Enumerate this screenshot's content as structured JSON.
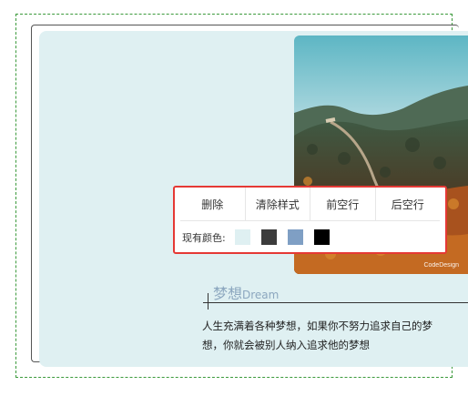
{
  "toolbar": {
    "buttons": [
      "删除",
      "清除样式",
      "前空行",
      "后空行"
    ],
    "color_label": "现有颜色:",
    "swatches": [
      "#dff0f2",
      "#3c3c3c",
      "#7f9fc4",
      "#000000"
    ]
  },
  "photo": {
    "watermark": "CodeDesign"
  },
  "heading": {
    "cn": "梦想",
    "en": "Dream"
  },
  "body": {
    "line1": "人生充满着各种梦想，如果你不努力追求自己的梦",
    "line2": "想，你就会被别人纳入追求他的梦想"
  },
  "colors": {
    "frame_dashed": "#3c9a3c",
    "card_bg": "#dff0f2",
    "heading": "#8ca7bf",
    "highlight_border": "#e53935"
  }
}
